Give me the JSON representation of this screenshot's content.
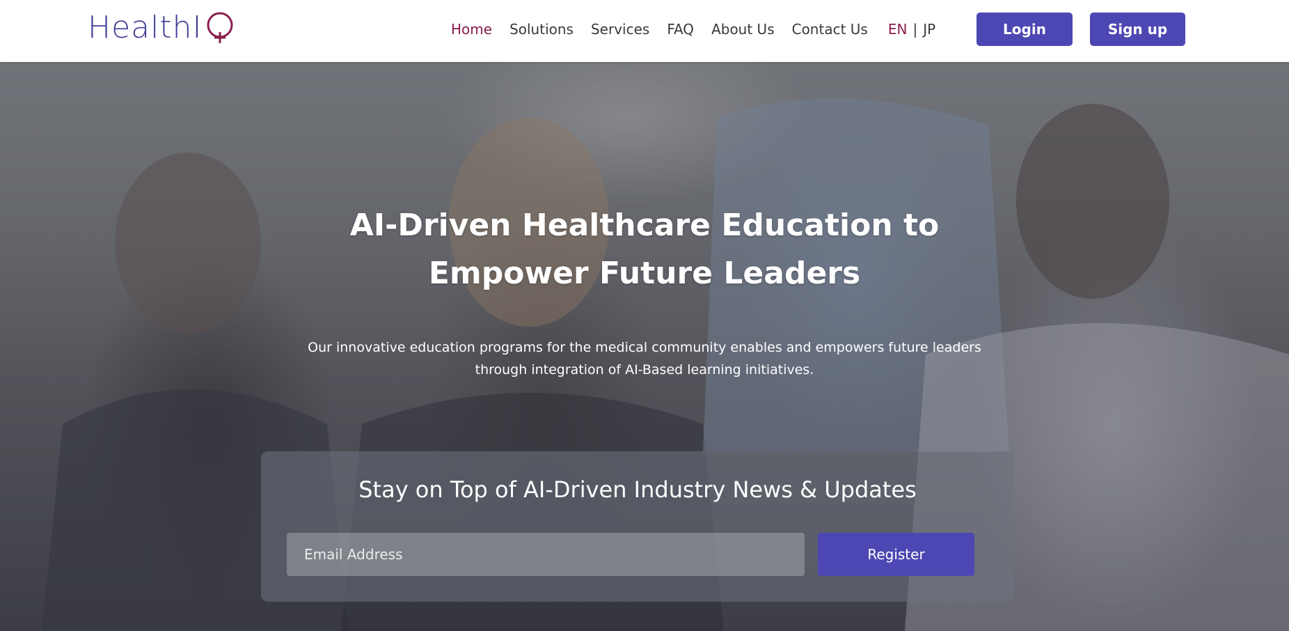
{
  "brand": {
    "name": "HealthIQ",
    "text": "HealthI",
    "colors": {
      "primary": "#3f3d96",
      "accent": "#8a1f4e"
    }
  },
  "nav": {
    "items": [
      {
        "label": "Home",
        "active": true
      },
      {
        "label": "Solutions",
        "active": false
      },
      {
        "label": "Services",
        "active": false
      },
      {
        "label": "FAQ",
        "active": false
      },
      {
        "label": "About Us",
        "active": false
      },
      {
        "label": "Contact Us",
        "active": false
      }
    ],
    "lang": {
      "en": "EN",
      "separator": "|",
      "jp": "JP",
      "active": "EN"
    }
  },
  "auth": {
    "login_label": "Login",
    "signup_label": "Sign up",
    "button_color": "#4d47b3"
  },
  "hero": {
    "title_line1": "AI-Driven Healthcare Education to",
    "title_line2": "Empower Future Leaders",
    "subtitle_line1": "Our innovative education programs for the medical community enables and empowers future leaders",
    "subtitle_line2": "through integration of AI-Based learning initiatives."
  },
  "newsletter": {
    "title": "Stay on Top of AI-Driven Industry News & Updates",
    "email_placeholder": "Email Address",
    "register_label": "Register"
  }
}
